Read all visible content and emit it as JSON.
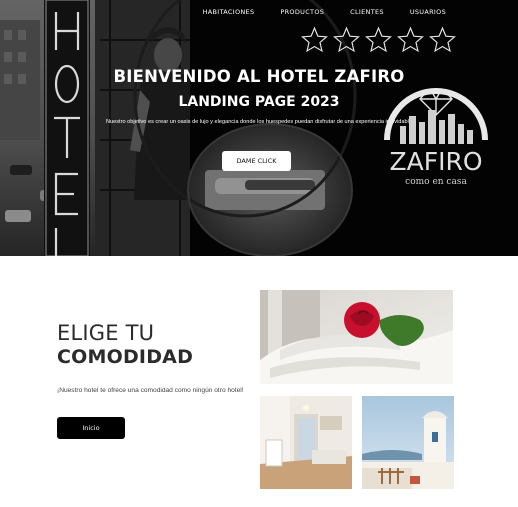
{
  "nav": {
    "items": [
      {
        "label": "HABITACIONES"
      },
      {
        "label": "PRODUCTOS"
      },
      {
        "label": "CLIENTES"
      },
      {
        "label": "USUARIOS"
      }
    ]
  },
  "hero": {
    "rating_stars": 5,
    "title": "BIENVENIDO AL HOTEL ZAFIRO",
    "subtitle": "LANDING PAGE 2023",
    "description": "Nuestro objetivo es crear un oasis de lujo y elegancia donde los huespedes puedan disfrutar de una experiencia inolvidable",
    "button_label": "DAME CLICK",
    "sign_letters": "HOTEL"
  },
  "logo": {
    "name": "ZAFIRO",
    "tagline": "como en casa"
  },
  "comfort": {
    "heading_line1": "ELIGE TU",
    "heading_line2": "COMODIDAD",
    "description": "¡Nuestro hotel te ofrece una comodidad como ningún otro hotel!",
    "button_label": "Inicio"
  },
  "colors": {
    "hero_bg": "#0d0d0d",
    "text_dark": "#2b2b2b",
    "button_dark": "#000000",
    "rose_red": "#c8102e"
  },
  "icons": {
    "rating": "star-outline-icon",
    "logo": "diamond-buildings-logo"
  }
}
